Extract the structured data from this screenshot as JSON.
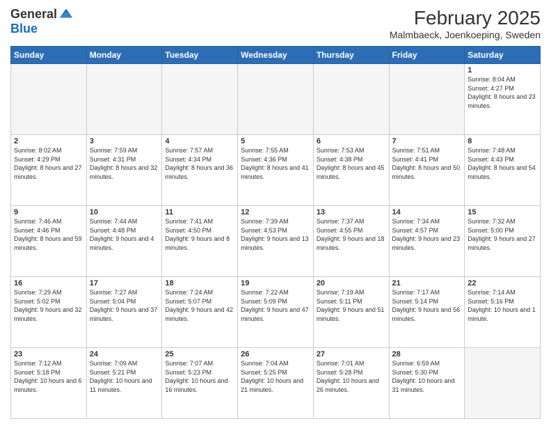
{
  "header": {
    "logo_general": "General",
    "logo_blue": "Blue",
    "month_year": "February 2025",
    "location": "Malmbaeck, Joenkoeping, Sweden"
  },
  "days_of_week": [
    "Sunday",
    "Monday",
    "Tuesday",
    "Wednesday",
    "Thursday",
    "Friday",
    "Saturday"
  ],
  "weeks": [
    [
      {
        "num": "",
        "info": ""
      },
      {
        "num": "",
        "info": ""
      },
      {
        "num": "",
        "info": ""
      },
      {
        "num": "",
        "info": ""
      },
      {
        "num": "",
        "info": ""
      },
      {
        "num": "",
        "info": ""
      },
      {
        "num": "1",
        "info": "Sunrise: 8:04 AM\nSunset: 4:27 PM\nDaylight: 8 hours and 23 minutes."
      }
    ],
    [
      {
        "num": "2",
        "info": "Sunrise: 8:02 AM\nSunset: 4:29 PM\nDaylight: 8 hours and 27 minutes."
      },
      {
        "num": "3",
        "info": "Sunrise: 7:59 AM\nSunset: 4:31 PM\nDaylight: 8 hours and 32 minutes."
      },
      {
        "num": "4",
        "info": "Sunrise: 7:57 AM\nSunset: 4:34 PM\nDaylight: 8 hours and 36 minutes."
      },
      {
        "num": "5",
        "info": "Sunrise: 7:55 AM\nSunset: 4:36 PM\nDaylight: 8 hours and 41 minutes."
      },
      {
        "num": "6",
        "info": "Sunrise: 7:53 AM\nSunset: 4:38 PM\nDaylight: 8 hours and 45 minutes."
      },
      {
        "num": "7",
        "info": "Sunrise: 7:51 AM\nSunset: 4:41 PM\nDaylight: 8 hours and 50 minutes."
      },
      {
        "num": "8",
        "info": "Sunrise: 7:48 AM\nSunset: 4:43 PM\nDaylight: 8 hours and 54 minutes."
      }
    ],
    [
      {
        "num": "9",
        "info": "Sunrise: 7:46 AM\nSunset: 4:46 PM\nDaylight: 8 hours and 59 minutes."
      },
      {
        "num": "10",
        "info": "Sunrise: 7:44 AM\nSunset: 4:48 PM\nDaylight: 9 hours and 4 minutes."
      },
      {
        "num": "11",
        "info": "Sunrise: 7:41 AM\nSunset: 4:50 PM\nDaylight: 9 hours and 8 minutes."
      },
      {
        "num": "12",
        "info": "Sunrise: 7:39 AM\nSunset: 4:53 PM\nDaylight: 9 hours and 13 minutes."
      },
      {
        "num": "13",
        "info": "Sunrise: 7:37 AM\nSunset: 4:55 PM\nDaylight: 9 hours and 18 minutes."
      },
      {
        "num": "14",
        "info": "Sunrise: 7:34 AM\nSunset: 4:57 PM\nDaylight: 9 hours and 23 minutes."
      },
      {
        "num": "15",
        "info": "Sunrise: 7:32 AM\nSunset: 5:00 PM\nDaylight: 9 hours and 27 minutes."
      }
    ],
    [
      {
        "num": "16",
        "info": "Sunrise: 7:29 AM\nSunset: 5:02 PM\nDaylight: 9 hours and 32 minutes."
      },
      {
        "num": "17",
        "info": "Sunrise: 7:27 AM\nSunset: 5:04 PM\nDaylight: 9 hours and 37 minutes."
      },
      {
        "num": "18",
        "info": "Sunrise: 7:24 AM\nSunset: 5:07 PM\nDaylight: 9 hours and 42 minutes."
      },
      {
        "num": "19",
        "info": "Sunrise: 7:22 AM\nSunset: 5:09 PM\nDaylight: 9 hours and 47 minutes."
      },
      {
        "num": "20",
        "info": "Sunrise: 7:19 AM\nSunset: 5:11 PM\nDaylight: 9 hours and 51 minutes."
      },
      {
        "num": "21",
        "info": "Sunrise: 7:17 AM\nSunset: 5:14 PM\nDaylight: 9 hours and 56 minutes."
      },
      {
        "num": "22",
        "info": "Sunrise: 7:14 AM\nSunset: 5:16 PM\nDaylight: 10 hours and 1 minute."
      }
    ],
    [
      {
        "num": "23",
        "info": "Sunrise: 7:12 AM\nSunset: 5:18 PM\nDaylight: 10 hours and 6 minutes."
      },
      {
        "num": "24",
        "info": "Sunrise: 7:09 AM\nSunset: 5:21 PM\nDaylight: 10 hours and 11 minutes."
      },
      {
        "num": "25",
        "info": "Sunrise: 7:07 AM\nSunset: 5:23 PM\nDaylight: 10 hours and 16 minutes."
      },
      {
        "num": "26",
        "info": "Sunrise: 7:04 AM\nSunset: 5:25 PM\nDaylight: 10 hours and 21 minutes."
      },
      {
        "num": "27",
        "info": "Sunrise: 7:01 AM\nSunset: 5:28 PM\nDaylight: 10 hours and 26 minutes."
      },
      {
        "num": "28",
        "info": "Sunrise: 6:59 AM\nSunset: 5:30 PM\nDaylight: 10 hours and 31 minutes."
      },
      {
        "num": "",
        "info": ""
      }
    ]
  ]
}
